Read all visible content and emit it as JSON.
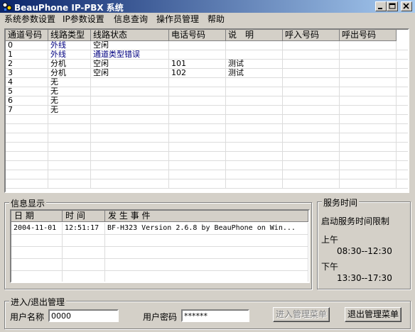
{
  "window": {
    "title": "BeauPhone IP-PBX 系统",
    "icon": "phone-app-icon"
  },
  "menu": [
    {
      "label": "系统参数设置"
    },
    {
      "label": "IP参数设置"
    },
    {
      "label": "信息查询"
    },
    {
      "label": "操作员管理"
    },
    {
      "label": "帮助"
    }
  ],
  "channel_table": {
    "columns": [
      "通道号码",
      "线路类型",
      "线路状态",
      "电话号码",
      "说　明",
      "呼入号码",
      "呼出号码"
    ],
    "rows": [
      {
        "ch": "0",
        "type": "外线",
        "status": "空闲",
        "phone": "",
        "note": "",
        "in": "",
        "out": ""
      },
      {
        "ch": "1",
        "type": "外线",
        "status": "通道类型错误",
        "phone": "",
        "note": "",
        "in": "",
        "out": ""
      },
      {
        "ch": "2",
        "type": "分机",
        "status": "空闲",
        "phone": "101",
        "note": "测试",
        "in": "",
        "out": ""
      },
      {
        "ch": "3",
        "type": "分机",
        "status": "空闲",
        "phone": "102",
        "note": "测试",
        "in": "",
        "out": ""
      },
      {
        "ch": "4",
        "type": "无",
        "status": "",
        "phone": "",
        "note": "",
        "in": "",
        "out": ""
      },
      {
        "ch": "5",
        "type": "无",
        "status": "",
        "phone": "",
        "note": "",
        "in": "",
        "out": ""
      },
      {
        "ch": "6",
        "type": "无",
        "status": "",
        "phone": "",
        "note": "",
        "in": "",
        "out": ""
      },
      {
        "ch": "7",
        "type": "无",
        "status": "",
        "phone": "",
        "note": "",
        "in": "",
        "out": ""
      }
    ]
  },
  "info": {
    "label": "信息显示",
    "columns": [
      "日 期",
      "时 间",
      "发 生 事 件"
    ],
    "rows": [
      {
        "date": "2004-11-01",
        "time": "12:51:17",
        "event": "BF-H323 Version 2.6.8 by BeauPhone on Win..."
      }
    ]
  },
  "service": {
    "label": "服务时间",
    "limit_text": "启动服务时间限制",
    "am_label": "上午",
    "am_time": "08:30--12:30",
    "pm_label": "下午",
    "pm_time": "13:30--17:30"
  },
  "login": {
    "label": "进入/退出管理",
    "user_label": "用户名称",
    "user_value": "0000",
    "pass_label": "用户密码",
    "pass_value": "******",
    "enter_button": "进入管理菜单",
    "exit_button": "退出管理菜单"
  }
}
